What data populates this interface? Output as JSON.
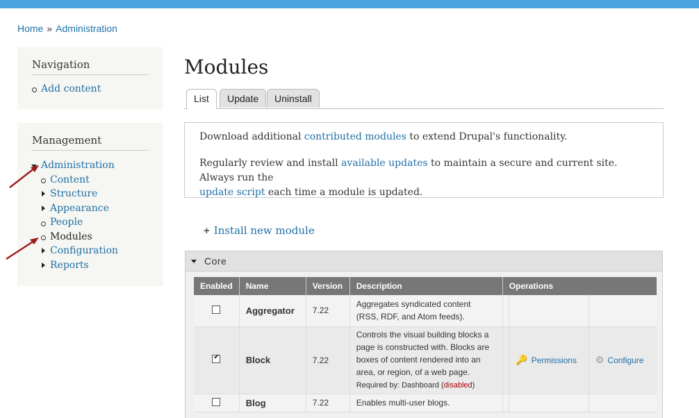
{
  "breadcrumb": {
    "home": "Home",
    "separator": "»",
    "current": "Administration"
  },
  "navigation": {
    "title": "Navigation",
    "items": [
      {
        "label": "Add content"
      }
    ]
  },
  "management": {
    "title": "Management",
    "root": {
      "label": "Administration"
    },
    "items": [
      {
        "label": "Content"
      },
      {
        "label": "Structure"
      },
      {
        "label": "Appearance"
      },
      {
        "label": "People"
      },
      {
        "label": "Modules"
      },
      {
        "label": "Configuration"
      },
      {
        "label": "Reports"
      }
    ]
  },
  "page": {
    "title": "Modules"
  },
  "tabs": [
    {
      "label": "List"
    },
    {
      "label": "Update"
    },
    {
      "label": "Uninstall"
    }
  ],
  "help": {
    "p1_pre": "Download additional ",
    "p1_link": "contributed modules",
    "p1_post": " to extend Drupal's functionality.",
    "p2_pre": "Regularly review and install ",
    "p2_link": "available updates",
    "p2_mid": " to maintain a secure and current site. Always run the",
    "p2_link2": "update script",
    "p2_post": " each time a module is updated."
  },
  "install_link": {
    "label": "Install new module",
    "icon": "+"
  },
  "fieldset": {
    "label": "Core"
  },
  "table": {
    "headers": [
      "Enabled",
      "Name",
      "Version",
      "Description",
      "Operations"
    ],
    "rows": [
      {
        "enabled": false,
        "name": "Aggregator",
        "version": "7.22",
        "desc1": "Aggregates syndicated content",
        "desc2": "(RSS, RDF, and Atom feeds)."
      },
      {
        "enabled": true,
        "name": "Block",
        "version": "7.22",
        "desc1": "Controls the visual building blocks a",
        "desc2": "page is constructed with. Blocks are",
        "desc3": "boxes of content rendered into an",
        "desc4": "area, or region, of a web page.",
        "req_pre": "Required by: Dashboard (",
        "req_status": "disabled",
        "req_post": ")",
        "op_permissions": "Permissions",
        "op_configure": "Configure"
      },
      {
        "enabled": false,
        "name": "Blog",
        "version": "7.22",
        "desc1": "Enables multi-user blogs."
      }
    ]
  },
  "colors": {
    "topbar": "#4aa3df",
    "link": "#1d6fa5",
    "arrow": "#a01c1c",
    "disabled": "#aa0000"
  }
}
